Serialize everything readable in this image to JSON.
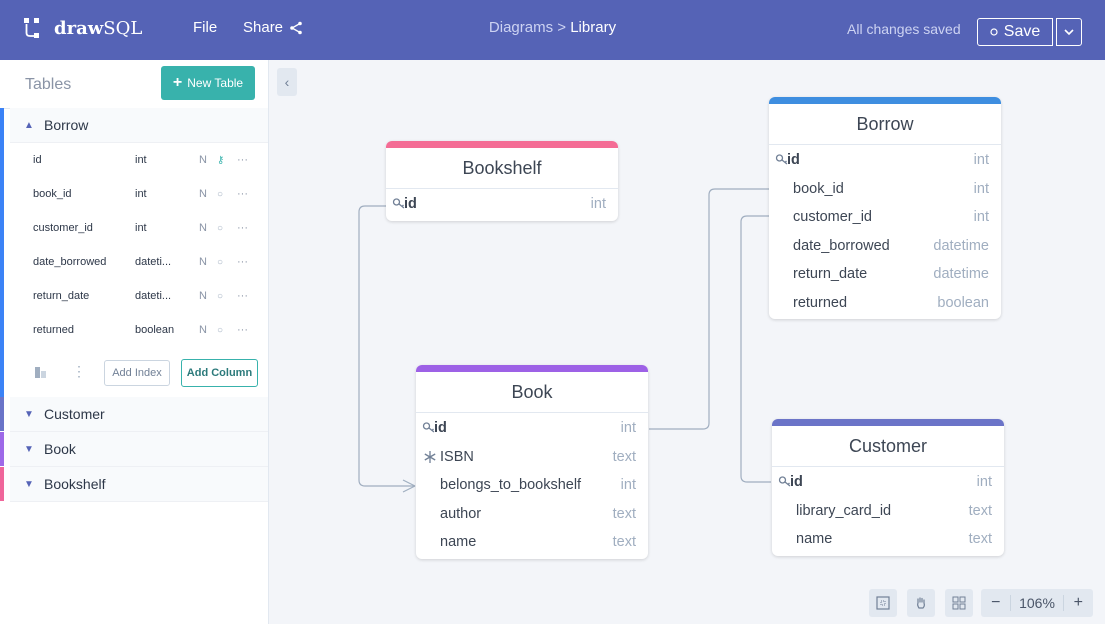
{
  "app": {
    "logo_bold": "draw",
    "logo_light": "SQL"
  },
  "menu": {
    "file": "File",
    "share": "Share"
  },
  "breadcrumb": {
    "parent": "Diagrams",
    "separator": ">",
    "current": "Library"
  },
  "status": {
    "saved": "All changes saved"
  },
  "save": {
    "label": "Save"
  },
  "sidebar": {
    "title": "Tables",
    "new_table": "New Table",
    "expanded_table": {
      "name": "Borrow",
      "color": "#3b82f6",
      "columns": [
        {
          "name": "id",
          "type": "int",
          "nullable": "N",
          "key": "pk"
        },
        {
          "name": "book_id",
          "type": "int",
          "nullable": "N",
          "key": "none"
        },
        {
          "name": "customer_id",
          "type": "int",
          "nullable": "N",
          "key": "none"
        },
        {
          "name": "date_borrowed",
          "type": "dateti...",
          "nullable": "N",
          "key": "none"
        },
        {
          "name": "return_date",
          "type": "dateti...",
          "nullable": "N",
          "key": "none"
        },
        {
          "name": "returned",
          "type": "boolean",
          "nullable": "N",
          "key": "none"
        }
      ],
      "add_index": "Add Index",
      "add_column": "Add Column"
    },
    "collapsed_tables": [
      {
        "name": "Customer",
        "color": "#6b74c8"
      },
      {
        "name": "Book",
        "color": "#9f6ae8"
      },
      {
        "name": "Bookshelf",
        "color": "#f0669a"
      }
    ]
  },
  "diagram": {
    "tables": [
      {
        "name": "Bookshelf",
        "color": "#f46c95",
        "columns": [
          {
            "name": "id",
            "type": "int",
            "pk": true
          }
        ]
      },
      {
        "name": "Borrow",
        "color": "#3e8ee0",
        "columns": [
          {
            "name": "id",
            "type": "int",
            "pk": true
          },
          {
            "name": "book_id",
            "type": "int"
          },
          {
            "name": "customer_id",
            "type": "int"
          },
          {
            "name": "date_borrowed",
            "type": "datetime"
          },
          {
            "name": "return_date",
            "type": "datetime"
          },
          {
            "name": "returned",
            "type": "boolean"
          }
        ]
      },
      {
        "name": "Book",
        "color": "#9d61e6",
        "columns": [
          {
            "name": "id",
            "type": "int",
            "pk": true
          },
          {
            "name": "ISBN",
            "type": "text",
            "unique": true
          },
          {
            "name": "belongs_to_bookshelf",
            "type": "int"
          },
          {
            "name": "author",
            "type": "text"
          },
          {
            "name": "name",
            "type": "text"
          }
        ]
      },
      {
        "name": "Customer",
        "color": "#6b74c8",
        "columns": [
          {
            "name": "id",
            "type": "int",
            "pk": true
          },
          {
            "name": "library_card_id",
            "type": "text"
          },
          {
            "name": "name",
            "type": "text"
          }
        ]
      }
    ]
  },
  "zoom": {
    "level": "106%",
    "minus": "−",
    "plus": "+"
  }
}
